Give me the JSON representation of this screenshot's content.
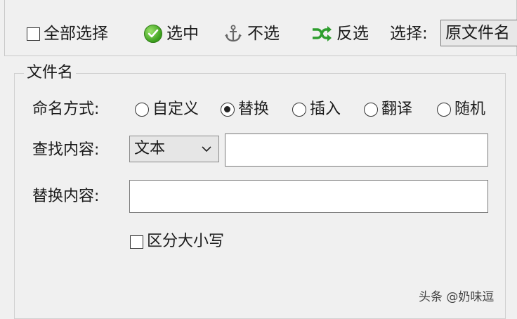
{
  "toolbar": {
    "select_all_label": "全部选择",
    "select_label": "选中",
    "deselect_label": "不选",
    "invert_label": "反选",
    "choose_label": "选择:",
    "choose_value": "原文件名"
  },
  "filename_group": {
    "title": "文件名",
    "naming_label": "命名方式:",
    "naming_options": [
      "自定义",
      "替换",
      "插入",
      "翻译",
      "随机"
    ],
    "naming_selected": "替换",
    "find_label": "查找内容:",
    "find_type_value": "文本",
    "find_value": "",
    "replace_label": "替换内容:",
    "replace_value": "",
    "case_sensitive_label": "区分大小写"
  },
  "watermark": "头条 @奶味逗",
  "colors": {
    "check_green": "#3a9d1c",
    "shuffle_green": "#2e9e2e"
  },
  "icons": [
    "check-circle-icon",
    "anchor-icon",
    "shuffle-icon",
    "chevron-down-icon"
  ]
}
